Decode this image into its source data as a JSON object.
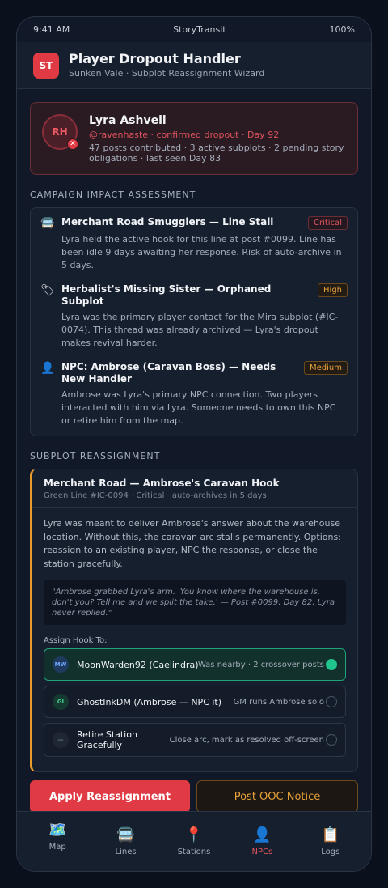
{
  "status": {
    "time": "9:41 AM",
    "carrier": "StoryTransit",
    "battery": "100%"
  },
  "header": {
    "logo": "ST",
    "title": "Player Dropout Handler",
    "subtitle": "Sunken Vale · Subplot Reassignment Wizard"
  },
  "player": {
    "initials": "RH",
    "name": "Lyra Ashveil",
    "handle_line": "@ravenhaste · confirmed dropout · Day 92",
    "stats": "47 posts contributed · 3 active subplots · 2 pending story obligations · last seen Day 83"
  },
  "impact": {
    "label": "CAMPAIGN IMPACT ASSESSMENT",
    "items": [
      {
        "icon": "🚍",
        "title": "Merchant Road Smugglers — Line Stall",
        "severity": "Critical",
        "desc": "Lyra held the active hook for this line at post #0099. Line has been idle 9 days awaiting her response. Risk of auto-archive in 5 days."
      },
      {
        "icon": "🏷",
        "title": "Herbalist's Missing Sister — Orphaned Subplot",
        "severity": "High",
        "desc": "Lyra was the primary player contact for the Mira subplot (#IC-0074). This thread was already archived — Lyra's dropout makes revival harder."
      },
      {
        "icon": "👤",
        "title": "NPC: Ambrose (Caravan Boss) — Needs New Handler",
        "severity": "Medium",
        "desc": "Ambrose was Lyra's primary NPC connection. Two players interacted with him via Lyra. Someone needs to own this NPC or retire him from the map."
      }
    ]
  },
  "reassign": {
    "label": "SUBPLOT REASSIGNMENT",
    "title": "Merchant Road — Ambrose's Caravan Hook",
    "subtitle": "Green Line #IC-0094 · Critical · auto-archives in 5 days",
    "desc": "Lyra was meant to deliver Ambrose's answer about the warehouse location. Without this, the caravan arc stalls permanently. Options: reassign to an existing player, NPC the response, or close the station gracefully.",
    "quote": "\"Ambrose grabbed Lyra's arm. 'You know where the warehouse is, don't you? Tell me and we split the take.' — Post #0099, Day 82. Lyra never replied.\"",
    "assign_label": "Assign Hook To:",
    "options": [
      {
        "initials": "MW",
        "name": "MoonWarden92 (Caelindra)",
        "note": "Was nearby · 2 crossover posts",
        "selected": true
      },
      {
        "initials": "GI",
        "name": "GhostInkDM (Ambrose — NPC it)",
        "note": "GM runs Ambrose solo",
        "selected": false
      },
      {
        "initials": "—",
        "name": "Retire Station Gracefully",
        "note": "Close arc, mark as resolved off-screen",
        "selected": false
      }
    ]
  },
  "actions": {
    "primary": "Apply Reassignment",
    "secondary": "Post OOC Notice"
  },
  "tabs": [
    {
      "icon": "🗺️",
      "label": "Map"
    },
    {
      "icon": "🚍",
      "label": "Lines"
    },
    {
      "icon": "📍",
      "label": "Stations"
    },
    {
      "icon": "👤",
      "label": "NPCs"
    },
    {
      "icon": "📋",
      "label": "Logs"
    }
  ],
  "colors": {
    "accent": "#e03a45",
    "warning": "#e8a23a",
    "success": "#22c48e",
    "background": "#111827"
  }
}
